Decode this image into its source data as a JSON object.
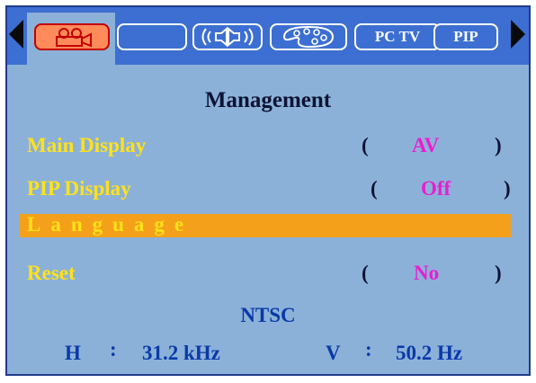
{
  "tabs": [
    {
      "label": "",
      "icon": "camcorder-icon",
      "active": true
    },
    {
      "label": "",
      "icon": "blank-tab-icon",
      "active": false
    },
    {
      "label": "",
      "icon": "speaker-icon",
      "active": false
    },
    {
      "label": "",
      "icon": "palette-icon",
      "active": false
    },
    {
      "label": "PC TV",
      "icon": "",
      "active": false
    },
    {
      "label": "PIP",
      "icon": "",
      "active": false
    }
  ],
  "menu": {
    "title": "Management",
    "items": [
      {
        "label": "Main Display",
        "value": "AV"
      },
      {
        "label": "PIP Display",
        "value": "Off"
      },
      {
        "label": "Language",
        "value": ""
      },
      {
        "label": "Reset",
        "value": "No"
      }
    ],
    "selected_index": 2
  },
  "status": {
    "standard": "NTSC",
    "h_label": "H",
    "h_value": "31.2 kHz",
    "v_label": "V",
    "v_value": "50.2 Hz",
    "separator": ":"
  },
  "colors": {
    "tab_bar": "#3c6fd1",
    "menu_bg": "#8cb1d9",
    "label_yellow": "#ffe21a",
    "value_magenta": "#e81fd0",
    "highlight_orange": "#f5a01a"
  }
}
